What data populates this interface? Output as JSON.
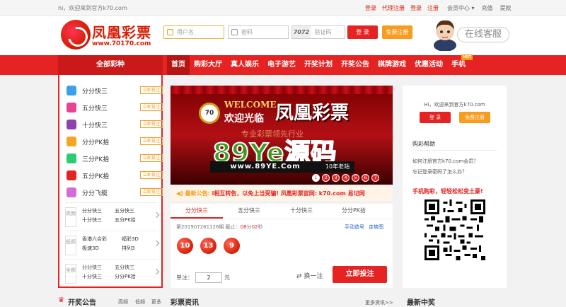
{
  "topbar": {
    "welcome": "hi，欢迎来到官方k70.com",
    "links_red": [
      "登录",
      "代理注册",
      "登录",
      "注册"
    ],
    "links_gray": [
      "会员中心 ▾",
      "充值",
      "提款"
    ]
  },
  "header": {
    "logo_name": "凤凰彩票",
    "logo_url": "www.70170.com",
    "username_placeholder": "用户名",
    "password_placeholder": "密码",
    "captcha_code": "7072",
    "captcha_placeholder": "验证码",
    "login_label": "登 录",
    "register_label": "免费注册",
    "customer_service": "在线客服"
  },
  "nav": {
    "all_games": "全部彩种",
    "items": [
      "首页",
      "购彩大厅",
      "真人娱乐",
      "电子游艺",
      "开奖计划",
      "开奖公告",
      "棋牌游戏",
      "优惠活动",
      "手机"
    ],
    "hot_badge": "HOT"
  },
  "sidebar": {
    "games": [
      {
        "name": "分分快三",
        "btn": "立即投注",
        "color": "#3aa0e8"
      },
      {
        "name": "五分快三",
        "btn": "立即投注",
        "color": "#e84393"
      },
      {
        "name": "十分快三",
        "btn": "立即投注",
        "color": "#8e44ad"
      },
      {
        "name": "分分PK拾",
        "btn": "立即投注",
        "color": "#f5a623"
      },
      {
        "name": "三分PK拾",
        "btn": "立即投注",
        "color": "#2ecc71"
      },
      {
        "name": "五分PK拾",
        "btn": "立即投注",
        "color": "#e52322"
      },
      {
        "name": "分分飞艇",
        "btn": "立即投注",
        "color": "#d36bd8"
      }
    ],
    "groups": [
      {
        "label": "高频",
        "cells": [
          "分分快三",
          "五分快三",
          "十分快三",
          "五分PK拾"
        ]
      },
      {
        "label": "低频",
        "cells": [
          "香港六合彩",
          "福彩3D",
          "极速3D",
          "排列3"
        ]
      },
      {
        "label": "全部",
        "cells": [
          "分分快三",
          "五分快三",
          "十分快三",
          "分分PK拾"
        ]
      }
    ]
  },
  "banner": {
    "badge": "70",
    "welcome_en": "WELCOME",
    "welcome_cn": "欢迎光临",
    "title": "凤凰彩票",
    "slogan": "专业彩票领先行业",
    "watermark": "89Ye源码",
    "url": "www.89YE.Com",
    "url_tag": "10年老站",
    "slides": [
      "1",
      "2",
      "3",
      "4",
      "5",
      "6",
      "7"
    ],
    "active_slide": 1
  },
  "notice": {
    "label": "◀) 最新公告:",
    "text": "i相互转告，以免上当受骗! 凤凰彩票官网: k70.com 易记网"
  },
  "lottery": {
    "tabs": [
      "分分快三",
      "五分快三",
      "十分快三",
      "分分PK拾"
    ],
    "issue_prefix": "第2019072611​26期 截止：",
    "countdown": "08",
    "countdown_sep1": "分",
    "countdown_sec": "02",
    "countdown_sep2": "秒",
    "manual": "手动选号",
    "trend": "走势图",
    "balls": [
      "10",
      "13",
      "9"
    ],
    "multiplier_label": "单注：",
    "multiplier_value": "2",
    "unit": "元",
    "swap": "⇄  换一注",
    "bet_button": "立即投注"
  },
  "right": {
    "hi": "Hi，欢迎来到官方k70.com",
    "login": "登 录",
    "register": "免费注册",
    "help_title": "购彩帮助",
    "q1": "如何注册官方k70.com会员？",
    "q2": "忘记登录密码了怎么办？",
    "promo": "手机购彩，轻轻松松变土豪!"
  },
  "bottom": {
    "notice_title": "开奖公告",
    "tabs": [
      "高频",
      "低频",
      "更多"
    ],
    "news_title": "彩票资讯",
    "more": "更多资讯>>",
    "winners_title": "最新中奖"
  }
}
